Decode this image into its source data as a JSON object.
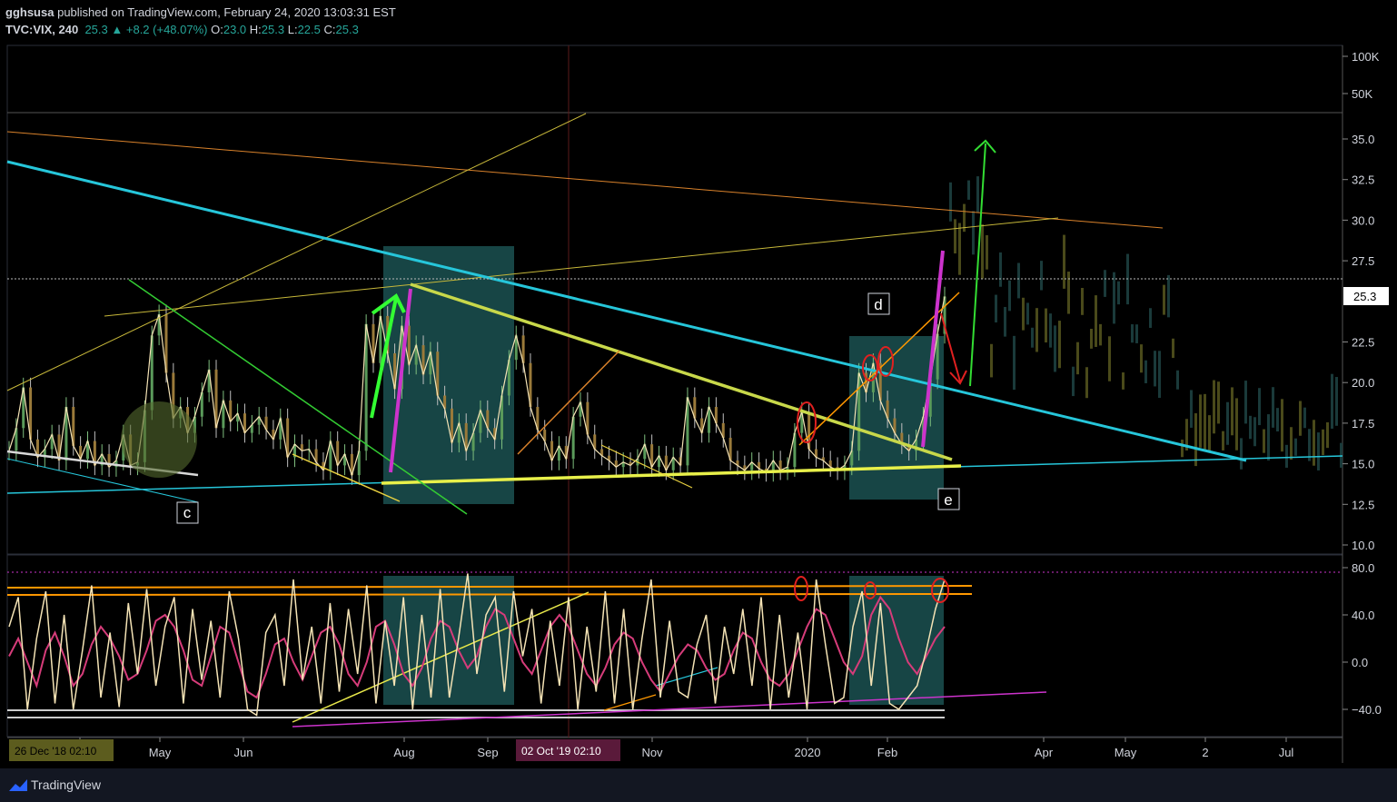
{
  "header": {
    "author": "gghsusa",
    "published_text": "published on TradingView.com, February 24, 2020 13:03:31 EST",
    "symbol": "TVC:VIX, 240",
    "last": "25.3",
    "change": "+8.2 (+48.07%)",
    "o_label": "O:",
    "o_val": "23.0",
    "h_label": "H:",
    "h_val": "25.3",
    "l_label": "L:",
    "l_val": "22.5",
    "c_label": "C:",
    "c_val": "25.3"
  },
  "footer": {
    "brand": "TradingView"
  },
  "colors": {
    "bg": "#000000",
    "cyan": "#26c6da",
    "yellow": "#e8e84a",
    "green": "#33dd33",
    "magenta": "#cc33cc",
    "orange": "#ff9800",
    "red": "#e02020",
    "teal_box": "#1f5c5c",
    "osc_main": "#f4e3b5",
    "osc_signal": "#d63c7a"
  },
  "chart_data": [
    {
      "type": "line",
      "title": "TVC:VIX, 240",
      "price_axis": {
        "ticks": [
          "100K",
          "50K",
          "35.0",
          "32.5",
          "30.0",
          "27.5",
          "25.3",
          "22.5",
          "20.0",
          "17.5",
          "15.0",
          "12.5",
          "10.0"
        ],
        "tick_values": [
          100000,
          50000,
          35.0,
          32.5,
          30.0,
          27.5,
          25.3,
          22.5,
          20.0,
          17.5,
          15.0,
          12.5,
          10.0
        ],
        "last_price_label": "25.3"
      },
      "time_axis": {
        "ticks": [
          "Apr",
          "May",
          "Jun",
          "Aug",
          "Sep",
          "Nov",
          "2020",
          "Feb",
          "Apr",
          "May",
          "2",
          "Jul"
        ],
        "crosshair_left": "26 Dec '18  02:10",
        "crosshair_mid": "02 Oct '19  02:10"
      },
      "annotations": [
        "c",
        "d",
        "e"
      ],
      "series": [
        {
          "values": [
            15.8,
            17.2,
            19.7,
            16.5,
            15.4,
            15.9,
            16.8,
            15.2,
            18.5,
            16.1,
            15.3,
            16.4,
            14.9,
            15.6,
            14.8,
            15.2,
            16.8,
            14.9,
            15.1,
            18.3,
            22.9,
            24.2,
            20.6,
            17.8,
            18.5,
            16.9,
            17.9,
            19.4,
            20.8,
            17.2,
            18.9,
            17.6,
            18.1,
            16.9,
            17.4,
            17.9,
            17.1,
            16.5,
            17.8,
            15.4,
            16.2,
            15.8,
            15.9,
            15.1,
            14.6,
            16.4,
            14.9,
            15.6,
            14.3,
            15.8,
            23.6,
            21.2,
            24.1,
            21.8,
            19.6,
            23.5,
            21.1,
            22.3,
            20.5,
            21.9,
            19.2,
            18.4,
            16.3,
            17.5,
            15.8,
            16.9,
            18.3,
            17.2,
            16.5,
            19.2,
            21.4,
            22.9,
            21.2,
            18.5,
            17.1,
            16.4,
            15.2,
            16.1,
            15.3,
            17.9,
            18.8,
            16.8,
            15.9,
            15.5,
            15.2,
            14.8,
            15.1,
            14.9,
            15.3,
            16.2,
            14.8,
            15.5,
            14.6,
            15.4,
            14.9,
            19.1,
            17.8,
            16.9,
            18.5,
            17.5,
            16.6,
            15.2,
            14.9,
            14.6,
            15.1,
            14.7,
            14.5,
            15.2,
            14.6,
            14.8,
            16.9,
            18.2,
            15.9,
            15.4,
            15.2,
            14.8,
            14.6,
            14.9,
            15.8,
            20.6,
            19.4,
            21.2,
            18.9,
            17.8,
            16.9,
            16.2,
            15.8,
            16.5,
            17.9,
            20.2,
            23.0,
            25.3
          ]
        }
      ]
    },
    {
      "type": "line",
      "title": "",
      "axis": {
        "ticks": [
          "80.0",
          "40.0",
          "0.0",
          "−40.0"
        ],
        "tick_values": [
          80,
          40,
          0,
          -40
        ]
      },
      "series": [
        {
          "values": [
            30,
            55,
            -40,
            20,
            60,
            -35,
            40,
            -40,
            10,
            65,
            -30,
            25,
            -38,
            50,
            -10,
            62,
            -20,
            30,
            55,
            -35,
            45,
            -15,
            35,
            -30,
            60,
            20,
            -40,
            -45,
            25,
            40,
            -20,
            70,
            -15,
            30,
            -35,
            50,
            -25,
            45,
            -10,
            65,
            -35,
            35,
            -20,
            55,
            -40,
            40,
            -30,
            62,
            -30,
            20,
            75,
            -10,
            40,
            55,
            -25,
            60,
            5,
            45,
            -35,
            35,
            -20,
            55,
            -40,
            30,
            -25,
            60,
            -35,
            45,
            -40,
            20,
            70,
            -30,
            35,
            -25,
            -30,
            15,
            40,
            -35,
            30,
            -10,
            45,
            -20,
            55,
            -40,
            40,
            -30,
            25,
            -40,
            70,
            15,
            -35,
            -30,
            30,
            60,
            -20,
            50,
            -35,
            -40,
            -30,
            -20,
            10,
            45,
            70
          ]
        },
        {
          "values": [
            5,
            20,
            0,
            -20,
            10,
            25,
            5,
            -20,
            -10,
            15,
            30,
            20,
            5,
            -15,
            -10,
            10,
            35,
            40,
            30,
            10,
            -15,
            -20,
            5,
            30,
            25,
            0,
            -25,
            -30,
            -10,
            15,
            20,
            0,
            -15,
            5,
            25,
            30,
            15,
            -10,
            -20,
            0,
            30,
            35,
            15,
            -10,
            -20,
            -5,
            20,
            35,
            30,
            10,
            -5,
            5,
            30,
            45,
            40,
            20,
            0,
            -10,
            10,
            30,
            40,
            30,
            10,
            -10,
            -20,
            -5,
            15,
            25,
            20,
            0,
            -15,
            -25,
            -10,
            5,
            15,
            10,
            -5,
            -15,
            -10,
            10,
            25,
            20,
            0,
            -15,
            -20,
            -10,
            10,
            30,
            45,
            40,
            20,
            0,
            -10,
            5,
            40,
            55,
            45,
            20,
            0,
            -10,
            5,
            20,
            30
          ]
        }
      ],
      "levels": [
        60,
        65,
        -45,
        -40
      ]
    }
  ]
}
